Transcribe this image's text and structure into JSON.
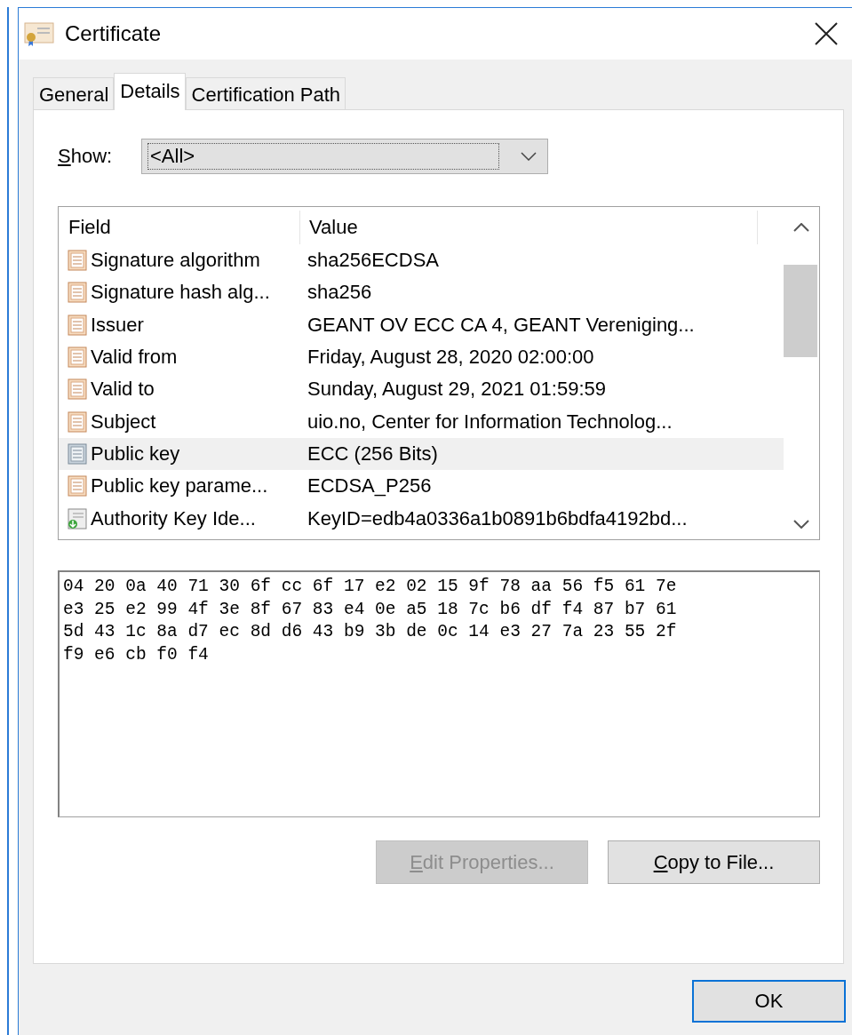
{
  "window": {
    "title": "Certificate"
  },
  "tabs": [
    {
      "label": "General",
      "selected": false
    },
    {
      "label": "Details",
      "selected": true
    },
    {
      "label": "Certification Path",
      "selected": false
    }
  ],
  "show": {
    "label": "Show:",
    "value": "<All>"
  },
  "table": {
    "columns": [
      "Field",
      "Value"
    ],
    "rows": [
      {
        "kind": "field",
        "field": "Signature algorithm",
        "value": "sha256ECDSA",
        "selected": false
      },
      {
        "kind": "field",
        "field": "Signature hash alg...",
        "value": "sha256",
        "selected": false
      },
      {
        "kind": "field",
        "field": "Issuer",
        "value": "GEANT OV ECC CA 4, GEANT Vereniging...",
        "selected": false
      },
      {
        "kind": "field",
        "field": "Valid from",
        "value": "Friday, August 28, 2020 02:00:00",
        "selected": false
      },
      {
        "kind": "field",
        "field": "Valid to",
        "value": "Sunday, August 29, 2021 01:59:59",
        "selected": false
      },
      {
        "kind": "field",
        "field": "Subject",
        "value": "uio.no, Center for Information Technolog...",
        "selected": false
      },
      {
        "kind": "key",
        "field": "Public key",
        "value": "ECC (256 Bits)",
        "selected": true
      },
      {
        "kind": "field",
        "field": "Public key parame...",
        "value": "ECDSA_P256",
        "selected": false
      },
      {
        "kind": "extension",
        "field": "Authority Key Ide...",
        "value": "KeyID=edb4a0336a1b0891b6bdfa4192bd...",
        "selected": false
      }
    ]
  },
  "detail_lines": [
    "04 20 0a 40 71 30 6f cc 6f 17 e2 02 15 9f 78 aa 56 f5 61 7e",
    "e3 25 e2 99 4f 3e 8f 67 83 e4 0e a5 18 7c b6 df f4 87 b7 61",
    "5d 43 1c 8a d7 ec 8d d6 43 b9 3b de 0c 14 e3 27 7a 23 55 2f",
    "f9 e6 cb f0 f4"
  ],
  "buttons": [
    {
      "label": "Edit Properties...",
      "disabled": true
    },
    {
      "label": "Copy to File...",
      "disabled": false
    }
  ],
  "ok": {
    "label": "OK"
  }
}
